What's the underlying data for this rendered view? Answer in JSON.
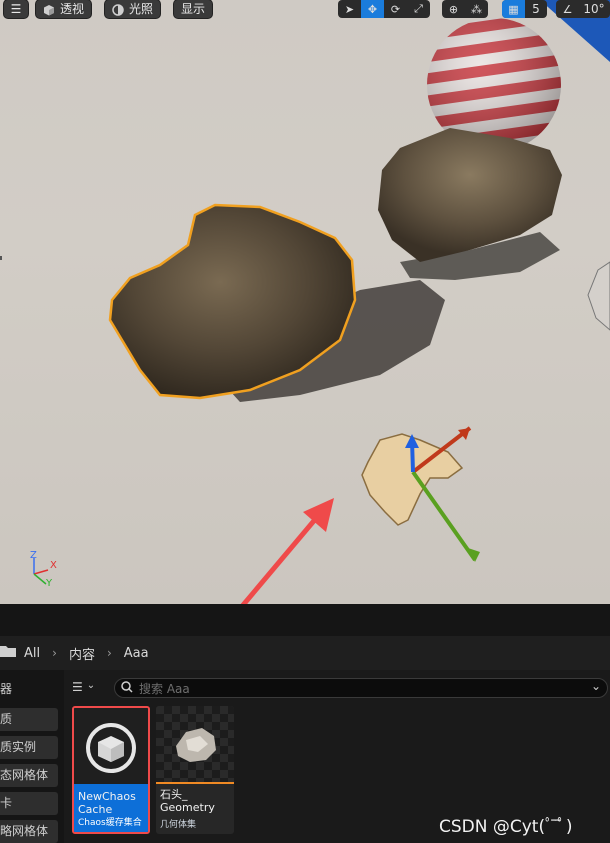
{
  "viewport": {
    "toolbar": {
      "menu_icon": "hamburger-icon",
      "perspective_label": "透视",
      "lighting_label": "光照",
      "show_label": "显示",
      "snap_value": "5",
      "angle_value": "10°"
    },
    "axis": {
      "z": "Z",
      "x": "X",
      "y": "Y"
    }
  },
  "breadcrumb": {
    "items": [
      "All",
      "内容",
      "Aaa"
    ]
  },
  "content_browser": {
    "left_items": [
      "器",
      "质",
      "质实例",
      "态网格体",
      "卡",
      "略网格体"
    ],
    "search_placeholder": "搜索 Aaa",
    "assets": [
      {
        "name_line1": "NewChaos",
        "name_line2": "Cache",
        "type": "Chaos缓存集合",
        "selected": true
      },
      {
        "name_line1": "石头_",
        "name_line2": "Geometry",
        "type": "几何体集",
        "selected": false
      }
    ]
  },
  "watermark": "CSDN @Cyt(ﾟ̄ ̄ﾟ)",
  "colors": {
    "accent": "#1a7cdc",
    "selection": "#f0a020",
    "annotation": "#ef4a4a"
  }
}
